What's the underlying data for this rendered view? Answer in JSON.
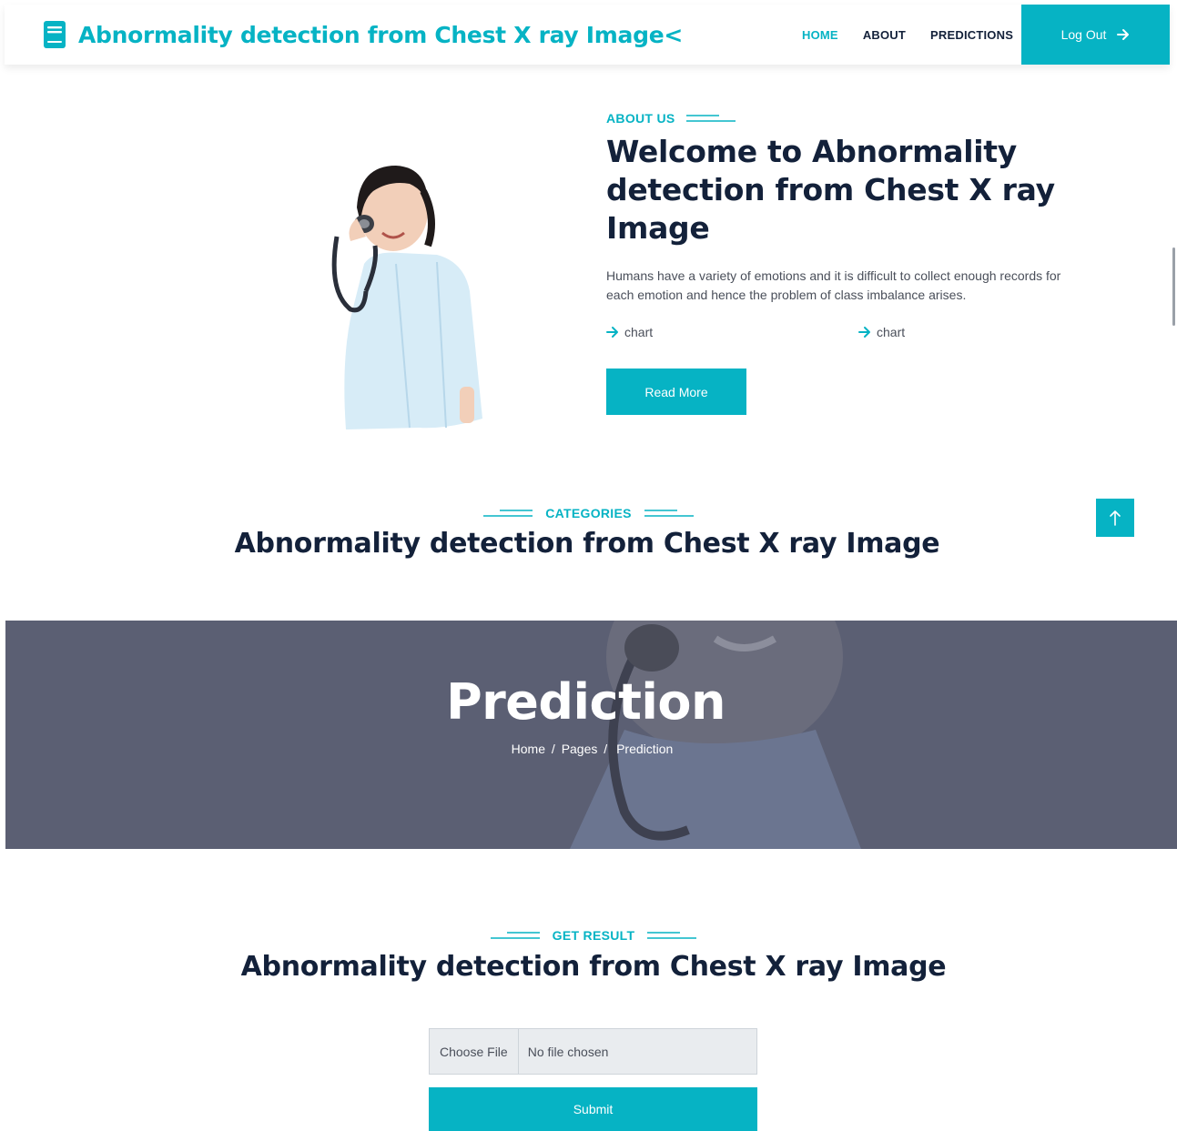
{
  "navbar": {
    "brand_title": "Abnormality detection from Chest X ray Image<",
    "links": [
      {
        "label": "HOME",
        "active": true
      },
      {
        "label": "ABOUT",
        "active": false
      },
      {
        "label": "PREDICTIONS",
        "active": false
      }
    ],
    "logout_label": "Log Out"
  },
  "about": {
    "kicker": "ABOUT US",
    "title": "Welcome to Abnormality detection from Chest X ray Image",
    "description": "Humans have a variety of emotions and it is difficult to collect enough records for each emotion and hence the problem of class imbalance arises.",
    "features": [
      "chart",
      "chart"
    ],
    "read_more_label": "Read More"
  },
  "categories": {
    "kicker": "CATEGORIES",
    "title": "Abnormality detection from Chest X ray Image"
  },
  "banner": {
    "title": "Prediction",
    "breadcrumb": [
      "Home",
      "Pages",
      "Prediction"
    ],
    "separator": "/"
  },
  "result": {
    "kicker": "GET RESULT",
    "title": "Abnormality detection from Chest X ray Image",
    "file_button_label": "Choose File",
    "file_status": "No file chosen",
    "submit_label": "Submit"
  },
  "colors": {
    "accent": "#06b3c4",
    "heading": "#13213a",
    "banner_overlay": "#5b5f73"
  },
  "icons": {
    "brand": "book-icon",
    "logout": "arrow-right-icon",
    "feature": "arrow-right-icon",
    "back_to_top": "arrow-up-icon"
  }
}
